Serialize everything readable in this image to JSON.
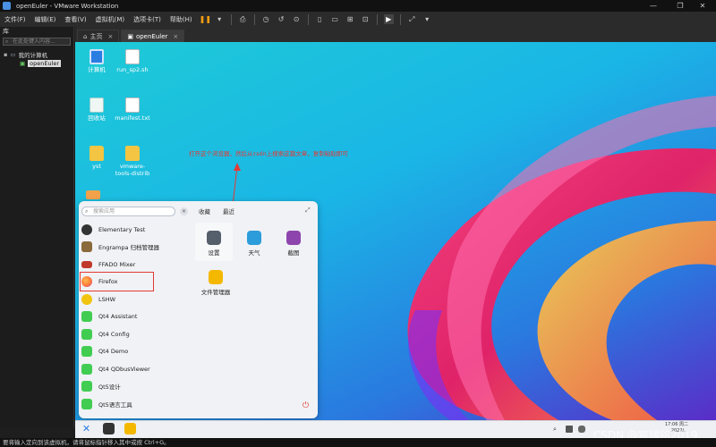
{
  "window": {
    "title": "openEuler - VMware Workstation"
  },
  "menu": [
    "文件(F)",
    "编辑(E)",
    "查看(V)",
    "虚拟机(M)",
    "选项卡(T)",
    "帮助(H)"
  ],
  "library": {
    "title": "库",
    "search_placeholder": "在此处键入内容...",
    "tree_root": "我的计算机",
    "tree_vm": "openEuler"
  },
  "tabs": [
    {
      "label": "主页"
    },
    {
      "label": "openEuler"
    }
  ],
  "desktop": {
    "icons": [
      {
        "label": "计算机",
        "icon": "computer-icon"
      },
      {
        "label": "run_sp2.sh",
        "icon": "script-file-icon"
      },
      {
        "label": "回收站",
        "icon": "trash-icon"
      },
      {
        "label": "manifest.txt",
        "icon": "text-file-icon"
      },
      {
        "label": "yst",
        "icon": "folder-icon"
      },
      {
        "label": "vmware-tools-distrib",
        "icon": "folder-icon"
      }
    ],
    "annotation": "打开这个浏览器，然后从csdn上搜索这篇文章，复制粘贴即可"
  },
  "launcher": {
    "search_placeholder": "搜索应用",
    "tab_favorites": "收藏",
    "tab_recent": "最近",
    "apps": [
      {
        "label": "Elementary Test",
        "color": "#333333"
      },
      {
        "label": "Engrampa 归档管理器",
        "color": "#8a6a3a"
      },
      {
        "label": "FFADO Mixer",
        "color": "#c0392b"
      },
      {
        "label": "Firefox",
        "color": "#ff7139"
      },
      {
        "label": "LSHW",
        "color": "#f1c40f"
      },
      {
        "label": "Qt4 Assistant",
        "color": "#41cd52"
      },
      {
        "label": "Qt4 Config",
        "color": "#41cd52"
      },
      {
        "label": "Qt4 Demo",
        "color": "#41cd52"
      },
      {
        "label": "Qt4 QDbusViewer",
        "color": "#41cd52"
      },
      {
        "label": "Qt5设计",
        "color": "#41cd52"
      },
      {
        "label": "Qt5语言工具",
        "color": "#41cd52"
      }
    ],
    "favorites": [
      {
        "label": "设置",
        "color": "#555f6b"
      },
      {
        "label": "天气",
        "color": "#2d9cdb"
      },
      {
        "label": "截图",
        "color": "#8e44ad"
      },
      {
        "label": "文件管理器",
        "color": "#f5b800"
      }
    ]
  },
  "taskbar": {
    "time": "17:06 周二",
    "date": "2022/..."
  },
  "status": "要将输入定向到该虚拟机，请将鼠标指针移入其中或按 Ctrl+G。",
  "watermark": "CSDN @宸瑞铭2019",
  "colors": {
    "accent": "#e53935",
    "desktop_top": "#1ecad6",
    "desktop_bottom": "#2a78df"
  }
}
